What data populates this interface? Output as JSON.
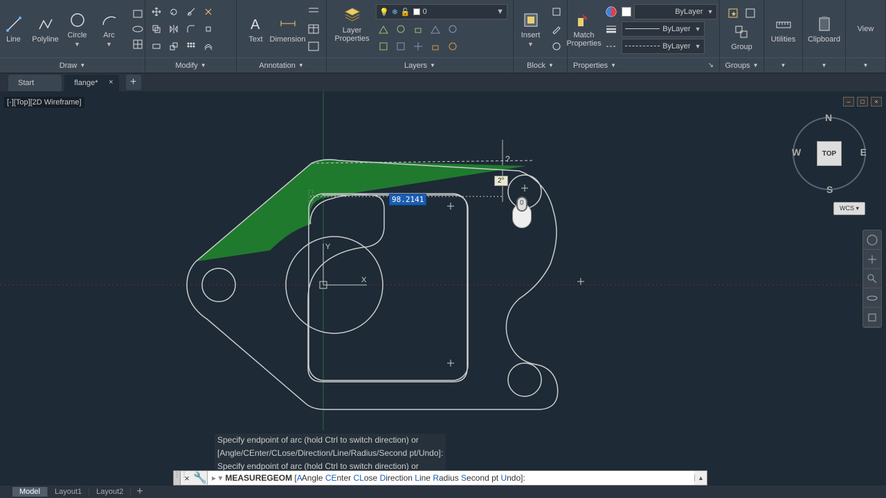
{
  "ribbon": {
    "draw": {
      "line": "Line",
      "polyline": "Polyline",
      "circle": "Circle",
      "arc": "Arc",
      "title": "Draw"
    },
    "modify": {
      "title": "Modify"
    },
    "annotation": {
      "text": "Text",
      "dimension": "Dimension",
      "title": "Annotation"
    },
    "layers": {
      "layerprops": "Layer\nProperties",
      "combo_value": "0",
      "title": "Layers"
    },
    "block": {
      "insert": "Insert",
      "title": "Block"
    },
    "properties": {
      "match": "Match\nProperties",
      "bylayer": "ByLayer",
      "title": "Properties"
    },
    "groups": {
      "group": "Group",
      "title": "Groups"
    },
    "utilities": {
      "title": "Utilities"
    },
    "clipboard": {
      "title": "Clipboard"
    },
    "view": {
      "title": "View"
    }
  },
  "tabs": {
    "start": "Start",
    "file": "flange*"
  },
  "viewport": {
    "label": "[-][Top][2D Wireframe]"
  },
  "viewcube": {
    "top": "TOP",
    "n": "N",
    "s": "S",
    "e": "E",
    "w": "W",
    "wcs": "WCS"
  },
  "drawing": {
    "dim_value": "98.2141",
    "angle_value": "2°",
    "tooltip": "?"
  },
  "history": {
    "l1": "Specify endpoint of arc (hold Ctrl to switch direction) or",
    "l2": "[Angle/CEnter/CLose/Direction/Line/Radius/Second pt/Undo]:",
    "l3": "Specify endpoint of arc (hold Ctrl to switch direction) or"
  },
  "cmd": {
    "name": "MEASUREGEOM",
    "opts": {
      "angle": "Angle",
      "a": "A",
      "center": "nter",
      "ce": "CE",
      "close": "ose",
      "cl": "CL",
      "direction": "irection",
      "d": "D",
      "line": "ine",
      "l": "L",
      "radius": "adius",
      "r": "R",
      "second": "econd pt",
      "s": "S",
      "undo": "ndo",
      "u": "U"
    },
    "open": "[",
    "close": "]:"
  },
  "layouts": {
    "model": "Model",
    "l1": "Layout1",
    "l2": "Layout2"
  }
}
